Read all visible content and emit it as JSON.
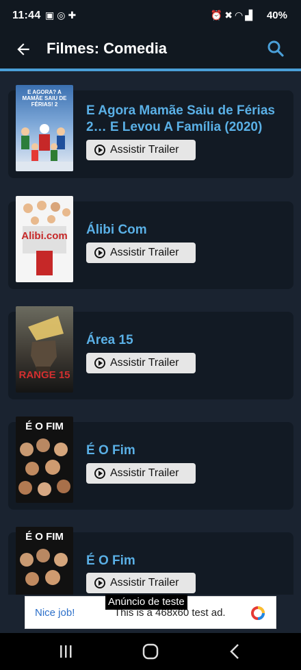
{
  "status_bar": {
    "time": "11:44",
    "notification_icons": [
      "image-icon",
      "whatsapp-icon",
      "puzzle-icon"
    ],
    "system_icons": [
      "alarm-icon",
      "mute-icon",
      "wifi-icon",
      "signal-icon"
    ],
    "battery": "40%"
  },
  "app_bar": {
    "title": "Filmes: Comedia"
  },
  "movies": [
    {
      "title": "E Agora Mamãe Saiu de Férias 2… E Levou A Família (2020)",
      "button": "Assistir Trailer",
      "poster_text": "E AGORA? A MAMÃE SAIU DE FÉRIAS! 2"
    },
    {
      "title": "Álibi Com",
      "button": "Assistir Trailer",
      "poster_text": "Alibi.com"
    },
    {
      "title": "Área 15",
      "button": "Assistir Trailer",
      "poster_text": "RANGE 15"
    },
    {
      "title": "É O Fim",
      "button": "Assistir Trailer",
      "poster_text": "É O FIM"
    },
    {
      "title": "É O Fim",
      "button": "Assistir Trailer",
      "poster_text": "É O FIM"
    }
  ],
  "ad": {
    "tooltip": "Anúncio de teste",
    "label": "Nice job!",
    "text": "This is a 468x60 test ad."
  },
  "colors": {
    "accent": "#4a9fd8",
    "title_blue": "#5ab0e6",
    "background": "#1a2330",
    "card": "#121a24"
  }
}
